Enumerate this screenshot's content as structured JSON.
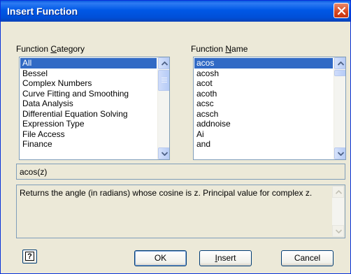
{
  "window": {
    "title": "Insert Function"
  },
  "category": {
    "label_pre": "Function ",
    "label_accel": "C",
    "label_post": "ategory",
    "items": [
      "All",
      "Bessel",
      "Complex Numbers",
      "Curve Fitting and Smoothing",
      "Data Analysis",
      "Differential Equation Solving",
      "Expression Type",
      "File Access",
      "Finance"
    ],
    "selected": "All"
  },
  "function_name": {
    "label_pre": "Function ",
    "label_accel": "N",
    "label_post": "ame",
    "items": [
      "acos",
      "acosh",
      "acot",
      "acoth",
      "acsc",
      "acsch",
      "addnoise",
      "Ai",
      "and"
    ],
    "selected": "acos"
  },
  "syntax": "acos(z)",
  "description": "Returns the angle (in radians) whose cosine is z. Principal value for complex z.",
  "buttons": {
    "help_glyph": "?",
    "ok": "OK",
    "insert_accel": "I",
    "insert_rest": "nsert",
    "cancel": "Cancel"
  },
  "icons": {
    "close": "close-icon",
    "scroll_up": "arrow-up-icon",
    "scroll_down": "arrow-down-icon",
    "help": "help-icon"
  },
  "colors": {
    "title_bar": "#0058e6",
    "selection": "#316ac5",
    "dialog_bg": "#ece9d8",
    "close_button": "#d6461e"
  }
}
